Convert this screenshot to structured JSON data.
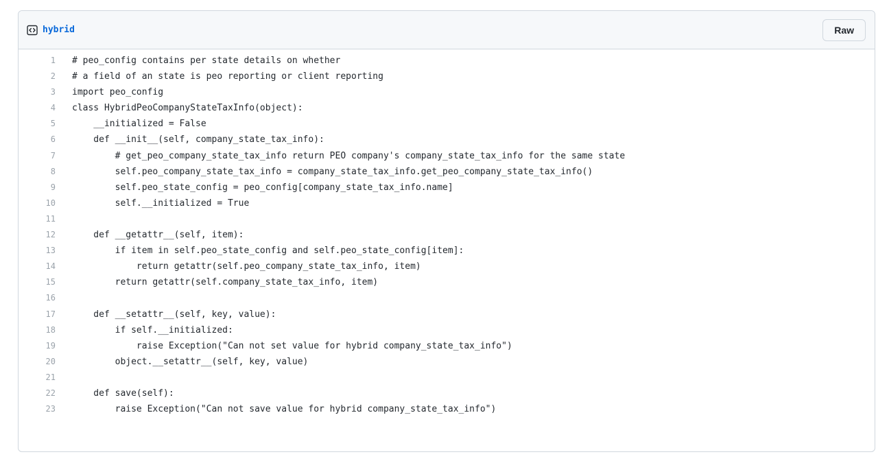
{
  "file": {
    "name": "hybrid",
    "raw_label": "Raw",
    "icon": "code-file-icon"
  },
  "lines": [
    {
      "number": "1",
      "code": "# peo_config contains per state details on whether"
    },
    {
      "number": "2",
      "code": "# a field of an state is peo reporting or client reporting"
    },
    {
      "number": "3",
      "code": "import peo_config"
    },
    {
      "number": "4",
      "code": "class HybridPeoCompanyStateTaxInfo(object):"
    },
    {
      "number": "5",
      "code": "    __initialized = False"
    },
    {
      "number": "6",
      "code": "    def __init__(self, company_state_tax_info):"
    },
    {
      "number": "7",
      "code": "        # get_peo_company_state_tax_info return PEO company's company_state_tax_info for the same state"
    },
    {
      "number": "8",
      "code": "        self.peo_company_state_tax_info = company_state_tax_info.get_peo_company_state_tax_info()"
    },
    {
      "number": "9",
      "code": "        self.peo_state_config = peo_config[company_state_tax_info.name]"
    },
    {
      "number": "10",
      "code": "        self.__initialized = True"
    },
    {
      "number": "11",
      "code": ""
    },
    {
      "number": "12",
      "code": "    def __getattr__(self, item):"
    },
    {
      "number": "13",
      "code": "        if item in self.peo_state_config and self.peo_state_config[item]:"
    },
    {
      "number": "14",
      "code": "            return getattr(self.peo_company_state_tax_info, item)"
    },
    {
      "number": "15",
      "code": "        return getattr(self.company_state_tax_info, item)"
    },
    {
      "number": "16",
      "code": ""
    },
    {
      "number": "17",
      "code": "    def __setattr__(self, key, value):"
    },
    {
      "number": "18",
      "code": "        if self.__initialized:"
    },
    {
      "number": "19",
      "code": "            raise Exception(\"Can not set value for hybrid company_state_tax_info\")"
    },
    {
      "number": "20",
      "code": "        object.__setattr__(self, key, value)"
    },
    {
      "number": "21",
      "code": ""
    },
    {
      "number": "22",
      "code": "    def save(self):"
    },
    {
      "number": "23",
      "code": "        raise Exception(\"Can not save value for hybrid company_state_tax_info\")"
    }
  ]
}
